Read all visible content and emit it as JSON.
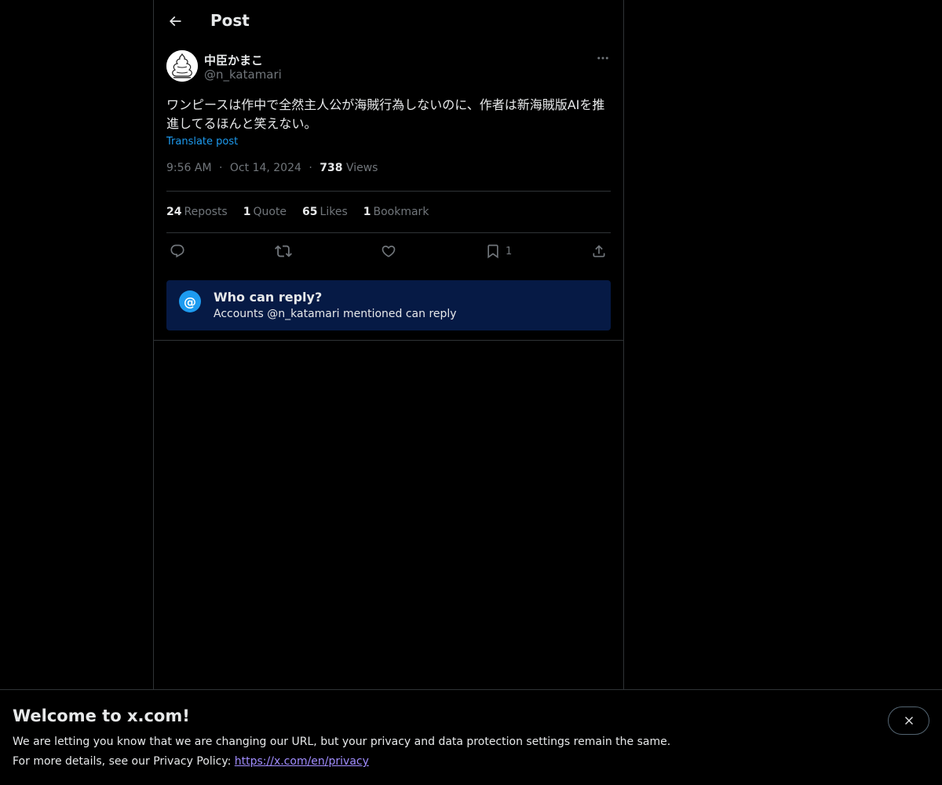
{
  "header": {
    "title": "Post"
  },
  "post": {
    "display_name": "中臣かまこ",
    "handle": "@n_katamari",
    "text": "ワンピースは作中で全然主人公が海賊行為しないのに、作者は新海賊版AIを推進してるほんと笑えない。",
    "translate_label": "Translate post",
    "time": "9:56 AM",
    "date": "Oct 14, 2024",
    "views_count": "738",
    "views_label": "Views",
    "separator": "·"
  },
  "stats": {
    "reposts_count": "24",
    "reposts_label": "Reposts",
    "quotes_count": "1",
    "quotes_label": "Quote",
    "likes_count": "65",
    "likes_label": "Likes",
    "bookmarks_count": "1",
    "bookmarks_label": "Bookmark"
  },
  "actions": {
    "reply_icon": "reply-icon",
    "repost_icon": "repost-icon",
    "like_icon": "heart-icon",
    "bookmark_icon": "bookmark-icon",
    "bookmark_count": "1",
    "share_icon": "share-icon"
  },
  "who_can_reply": {
    "icon_glyph": "@",
    "title": "Who can reply?",
    "subtitle": "Accounts @n_katamari mentioned can reply"
  },
  "banner": {
    "title": "Welcome to x.com!",
    "line1": "We are letting you know that we are changing our URL, but your privacy and data protection settings remain the same.",
    "line2_prefix": "For more details, see our Privacy Policy: ",
    "link": "https://x.com/en/privacy"
  },
  "colors": {
    "background": "#000000",
    "accent": "#1d9bf0",
    "muted": "#71767b",
    "reply_box": "#061a45",
    "link_visited": "#a18dff"
  }
}
